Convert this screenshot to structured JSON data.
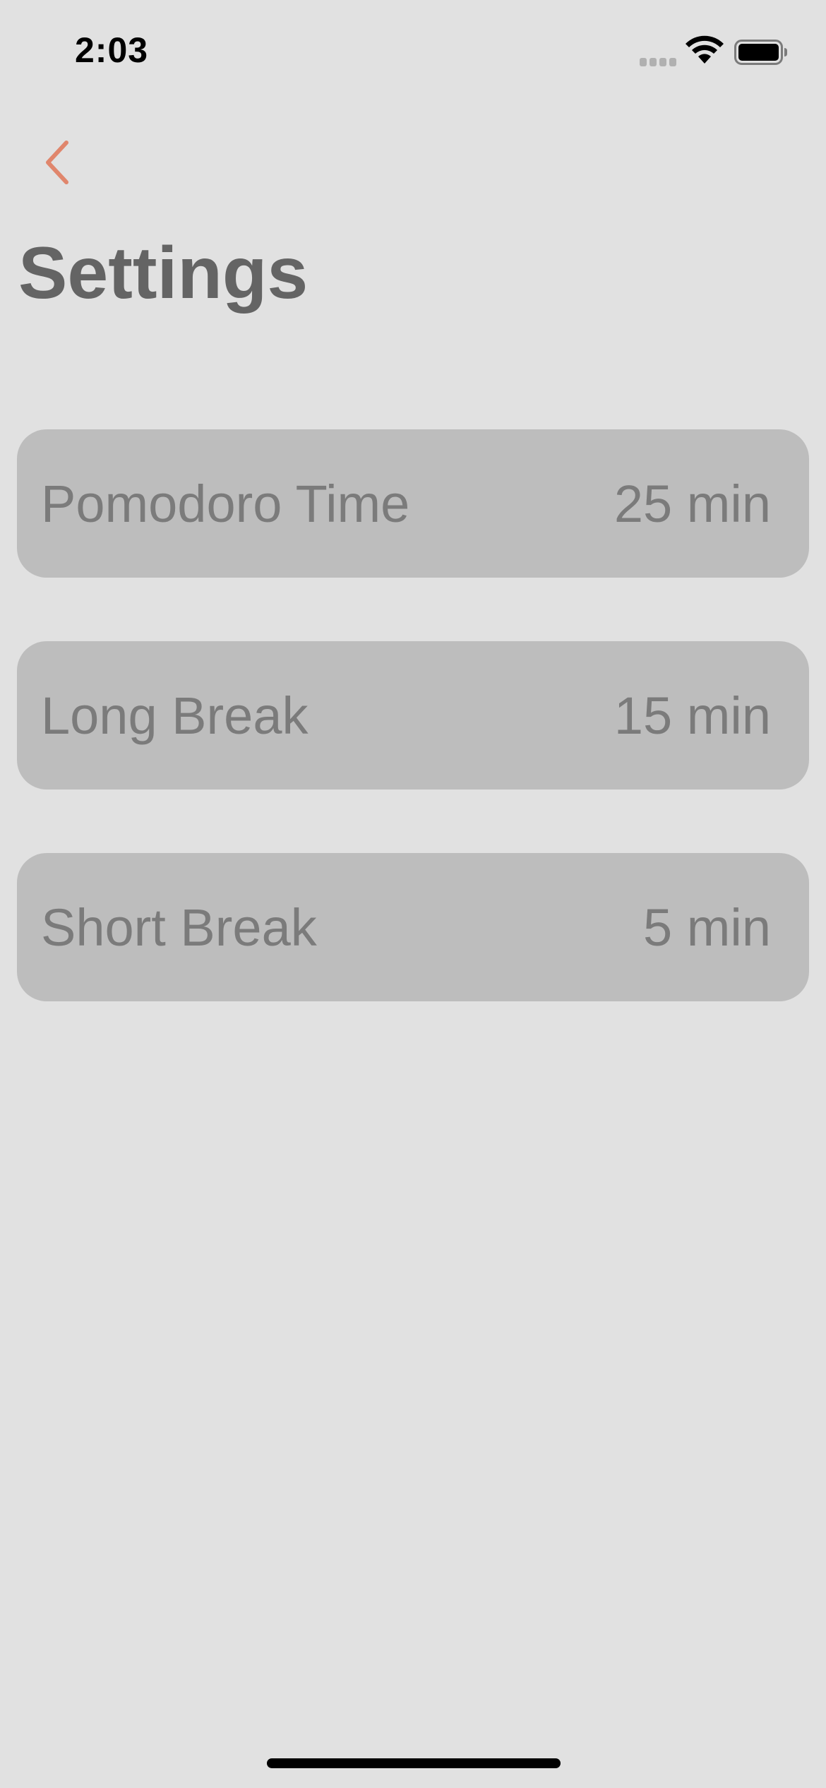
{
  "status_bar": {
    "time": "2:03"
  },
  "nav": {
    "back_icon": "chevron-left-icon",
    "accent_color": "#e0866c"
  },
  "page": {
    "title": "Settings"
  },
  "settings": [
    {
      "label": "Pomodoro Time",
      "value": "25 min"
    },
    {
      "label": "Long Break",
      "value": "15 min"
    },
    {
      "label": "Short Break",
      "value": "5 min"
    }
  ]
}
